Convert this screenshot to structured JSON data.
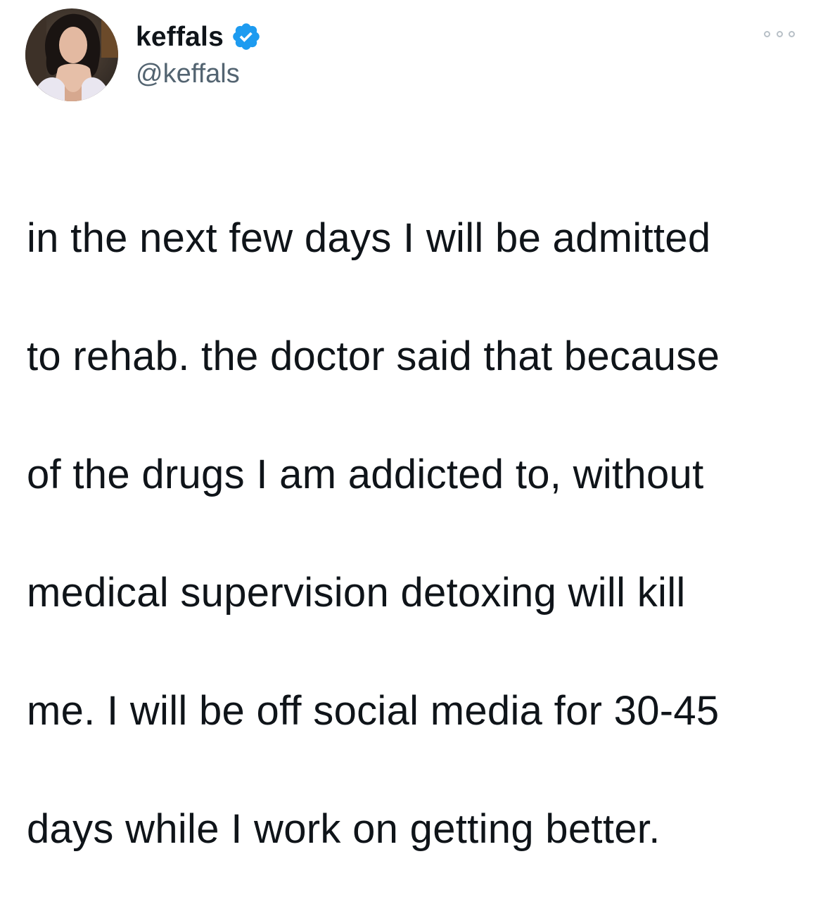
{
  "author": {
    "display_name": "keffals",
    "handle": "@keffals",
    "verified": true,
    "verified_color": "#1d9bf0"
  },
  "avatar": {
    "icon": "profile-photo"
  },
  "menu": {
    "icon": "more-options-icon"
  },
  "tweet": {
    "lines": [
      "in the next few days I will be admitted",
      "to rehab. the doctor said that because",
      "of the drugs I am addicted to, without",
      "medical supervision detoxing will kill",
      "me. I will be off social media for 30-45",
      "days while I work on getting better."
    ]
  }
}
